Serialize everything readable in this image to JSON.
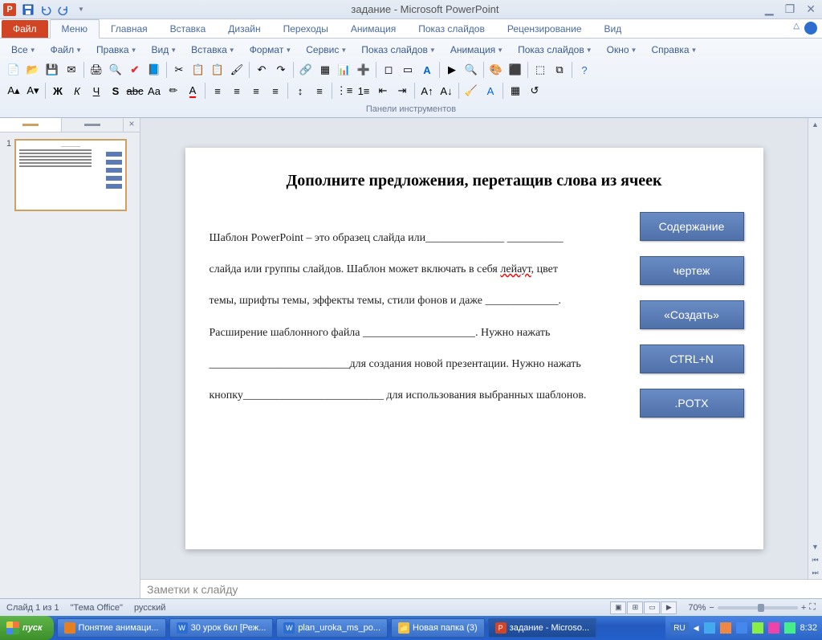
{
  "titlebar": {
    "app_letter": "P",
    "title": "задание - Microsoft PowerPoint"
  },
  "tabs": {
    "file": "Файл",
    "items": [
      "Меню",
      "Главная",
      "Вставка",
      "Дизайн",
      "Переходы",
      "Анимация",
      "Показ слайдов",
      "Рецензирование",
      "Вид"
    ],
    "active_index": 0
  },
  "menu_bar": {
    "items": [
      "Все",
      "Файл",
      "Правка",
      "Вид",
      "Вставка",
      "Формат",
      "Сервис",
      "Показ слайдов",
      "Анимация",
      "Показ слайдов",
      "Окно",
      "Справка"
    ]
  },
  "ribbon_group_label": "Панели инструментов",
  "thumb": {
    "slide_number": "1"
  },
  "slide": {
    "title": "Дополните предложения, перетащив слова из ячеек",
    "body_html": "Шаблон PowerPoint – это образец слайда или______________ __________ слайда или группы слайдов. Шаблон может включать в себя <span class='squiggle'>лейаут</span>, цвет темы, шрифты темы, эффекты темы, стили фонов и даже _____________. Расширение шаблонного файла ____________________. Нужно нажать _________________________для создания новой презентации. Нужно нажать кнопку_________________________ для использования выбранных шаблонов.",
    "answers": [
      "Содержание",
      "чертеж",
      "«Создать»",
      "CTRL+N",
      ".POTX"
    ]
  },
  "notes_placeholder": "Заметки к слайду",
  "statusbar": {
    "slide_info": "Слайд 1 из 1",
    "theme": "\"Тема Office\"",
    "language": "русский",
    "zoom": "70%"
  },
  "taskbar": {
    "start": "пуск",
    "items": [
      {
        "icon_bg": "#e67e22",
        "label": "Понятие анимаци..."
      },
      {
        "icon_bg": "#2a6dd3",
        "label": "30 урок 6кл [Реж...",
        "icon_text": "W"
      },
      {
        "icon_bg": "#2a6dd3",
        "label": "plan_uroka_ms_po...",
        "icon_text": "W"
      },
      {
        "icon_bg": "#f0c040",
        "label": "Новая папка (3)",
        "icon_text": "📁"
      },
      {
        "icon_bg": "#d14424",
        "label": "задание - Microso...",
        "icon_text": "P",
        "active": true
      }
    ],
    "lang": "RU",
    "time": "8:32"
  }
}
